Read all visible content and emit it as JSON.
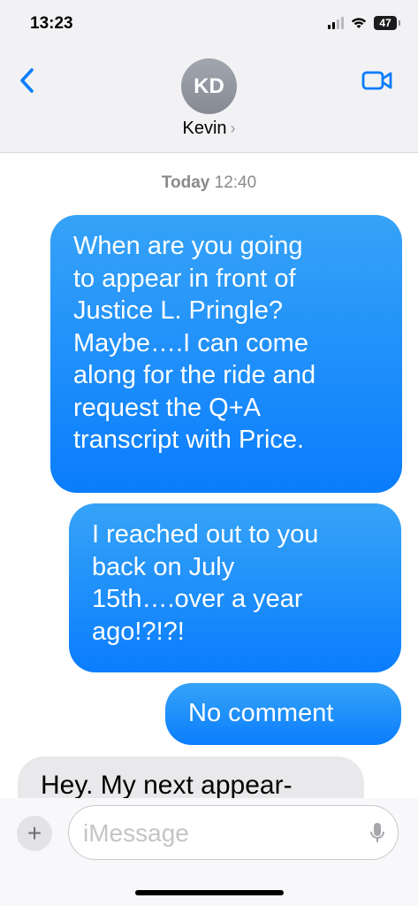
{
  "status_bar": {
    "time": "13:23",
    "battery": "47"
  },
  "header": {
    "avatar_initials": "KD",
    "contact_name": "Kevin",
    "chevron": "›"
  },
  "thread": {
    "timestamp_day": "Today",
    "timestamp_time": "12:40",
    "messages": [
      {
        "direction": "outgoing",
        "lines": [
          "When are you going",
          "to appear in front of",
          "Justice L. Pringle?",
          "Maybe….I can come",
          "along for the ride and",
          "request the Q+A",
          "transcript with Price."
        ]
      },
      {
        "direction": "outgoing",
        "lines": [
          "I reached out to you",
          "back on July",
          "15th….over a year",
          "ago!?!?!"
        ]
      },
      {
        "direction": "outgoing",
        "lines": [
          "No comment"
        ]
      },
      {
        "direction": "incoming",
        "lines": [
          "Hey. My next appear-"
        ]
      }
    ]
  },
  "composer": {
    "placeholder": "iMessage",
    "plus": "+"
  },
  "icons": {
    "back": "chevron-left-icon",
    "video": "video-camera-icon",
    "mic": "microphone-icon",
    "signal": "cellular-signal-icon",
    "wifi": "wifi-icon",
    "battery": "battery-icon"
  },
  "colors": {
    "accent": "#0a7dfd",
    "bubble_top": "#36a3f7",
    "incoming": "#e9e9eb"
  }
}
